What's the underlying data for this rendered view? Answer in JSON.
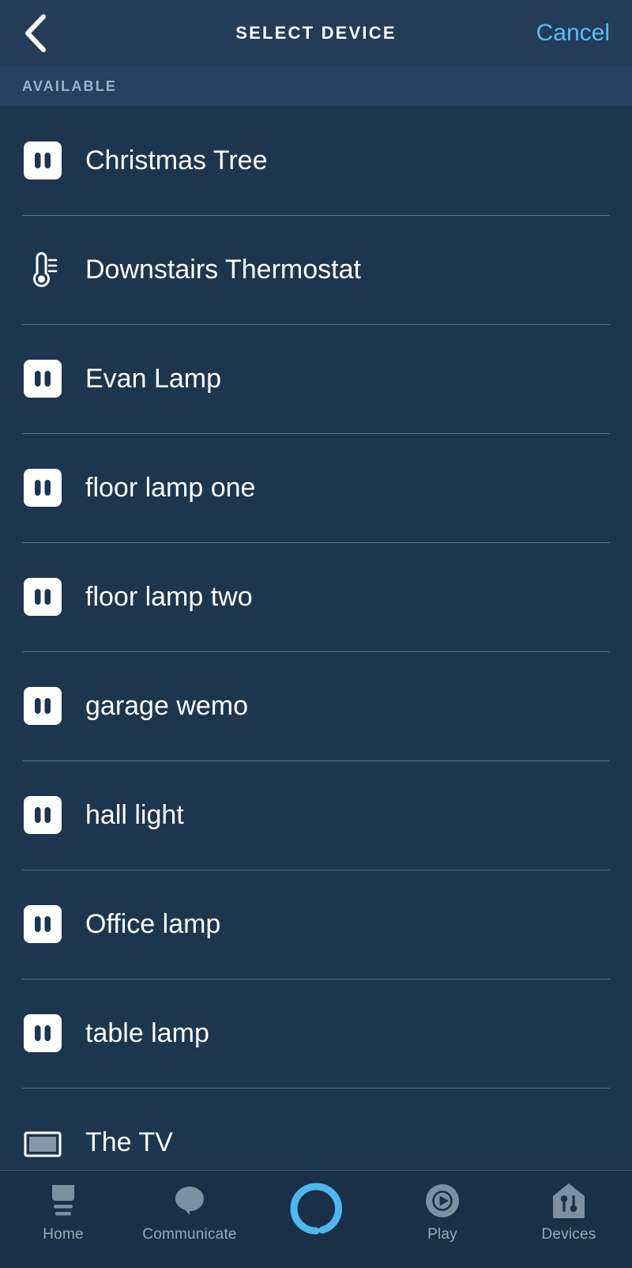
{
  "header": {
    "title": "SELECT DEVICE",
    "back_icon": "chevron-left-icon",
    "cancel_label": "Cancel"
  },
  "section": {
    "label": "AVAILABLE"
  },
  "devices": [
    {
      "name": "Christmas Tree",
      "icon": "smart-plug-icon"
    },
    {
      "name": "Downstairs Thermostat",
      "icon": "thermostat-icon"
    },
    {
      "name": "Evan Lamp",
      "icon": "smart-plug-icon"
    },
    {
      "name": "floor lamp one",
      "icon": "smart-plug-icon"
    },
    {
      "name": "floor lamp two",
      "icon": "smart-plug-icon"
    },
    {
      "name": "garage wemo",
      "icon": "smart-plug-icon"
    },
    {
      "name": "hall light",
      "icon": "smart-plug-icon"
    },
    {
      "name": "Office lamp",
      "icon": "smart-plug-icon"
    },
    {
      "name": "table lamp",
      "icon": "smart-plug-icon"
    },
    {
      "name": "The TV",
      "icon": "tv-icon"
    }
  ],
  "bottom_nav": [
    {
      "label": "Home",
      "icon": "home-speaker-icon"
    },
    {
      "label": "Communicate",
      "icon": "speech-bubble-icon"
    },
    {
      "label": "",
      "icon": "alexa-ring-icon"
    },
    {
      "label": "Play",
      "icon": "play-circle-icon"
    },
    {
      "label": "Devices",
      "icon": "devices-house-plug-icon"
    }
  ],
  "colors": {
    "header_bg": "#233d59",
    "band_bg": "#264260",
    "list_bg": "#1d3650",
    "nav_bg": "#1a3048",
    "accent_blue": "#5bbcef",
    "text_primary": "#ffffff",
    "text_muted": "#9aa8b8",
    "divider": "#8fa3b6"
  }
}
